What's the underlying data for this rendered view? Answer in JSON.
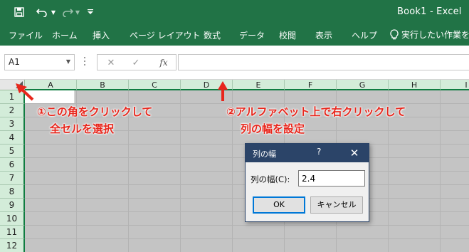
{
  "titlebar": {
    "app_title": "Book1  -  Excel",
    "icons": {
      "save": "save-icon",
      "undo": "undo-icon",
      "redo": "redo-icon",
      "customize": "customize-qat-icon"
    }
  },
  "ribbon": {
    "tabs": [
      "ファイル",
      "ホーム",
      "挿入",
      "ページ レイアウト",
      "数式",
      "データ",
      "校閲",
      "表示",
      "ヘルプ"
    ],
    "tell_me": "実行したい作業を入",
    "tell_me_icon": "lightbulb-icon"
  },
  "formula_bar": {
    "name_box": "A1",
    "fx_label": "fx",
    "formula_value": ""
  },
  "grid": {
    "columns": [
      "A",
      "B",
      "C",
      "D",
      "E",
      "F",
      "G",
      "H",
      "I"
    ],
    "rows": [
      "1",
      "2",
      "3",
      "4",
      "5",
      "6",
      "7",
      "8",
      "9",
      "10",
      "11",
      "12"
    ]
  },
  "annotations": {
    "note1_line1": "①この角をクリックして",
    "note1_line2": "全セルを選択",
    "note2_line1": "②アルファベット上で右クリックして",
    "note2_line2": "列の幅を設定",
    "arrow_color": "#e8261c"
  },
  "dialog": {
    "title": "列の幅",
    "help": "?",
    "close": "✕",
    "label": "列の幅(C):",
    "value": "2.4",
    "ok_label": "OK",
    "cancel_label": "キャンセル"
  },
  "colors": {
    "excel_green": "#217346",
    "header_green": "#d3ecd9",
    "dialog_title": "#2b4468"
  }
}
